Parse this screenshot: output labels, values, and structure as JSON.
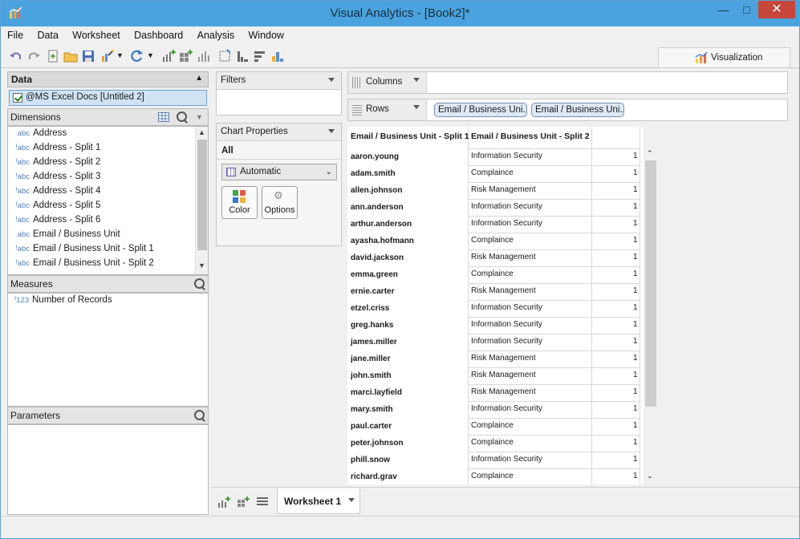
{
  "window": {
    "title": "Visual Analytics - [Book2]*",
    "controls": {
      "minimize": "—",
      "maximize": "□",
      "close": "✕"
    }
  },
  "menu": [
    "File",
    "Data",
    "Worksheet",
    "Dashboard",
    "Analysis",
    "Window"
  ],
  "tabs": {
    "visualization": "Visualization"
  },
  "data_panel": {
    "title": "Data",
    "datasource": "@MS Excel Docs [Untitled 2]"
  },
  "dimensions": {
    "title": "Dimensions",
    "items": [
      {
        "type": "abc",
        "label": "Address"
      },
      {
        "type": "fabc",
        "label": "Address - Split 1"
      },
      {
        "type": "fabc",
        "label": "Address - Split 2"
      },
      {
        "type": "fabc",
        "label": "Address - Split 3"
      },
      {
        "type": "fabc",
        "label": "Address - Split 4"
      },
      {
        "type": "fabc",
        "label": "Address - Split 5"
      },
      {
        "type": "fabc",
        "label": "Address - Split 6"
      },
      {
        "type": "abc",
        "label": "Email / Business Unit"
      },
      {
        "type": "fabc",
        "label": "Email / Business Unit - Split 1"
      },
      {
        "type": "fabc",
        "label": "Email / Business Unit - Split 2"
      }
    ]
  },
  "measures": {
    "title": "Measures",
    "items": [
      {
        "type": "f123",
        "label": "Number of Records"
      }
    ]
  },
  "parameters": {
    "title": "Parameters"
  },
  "filters": {
    "title": "Filters"
  },
  "chart_properties": {
    "title": "Chart Properties",
    "all_label": "All",
    "mark_type": "Automatic",
    "color_label": "Color",
    "options_label": "Options"
  },
  "shelves": {
    "columns_label": "Columns",
    "rows_label": "Rows",
    "row_pills": [
      "Email / Business Uni...",
      "Email / Business Uni..."
    ]
  },
  "table": {
    "headers": [
      "Email / Business Unit - Split 1",
      "Email / Business Unit - Split 2"
    ],
    "rows": [
      [
        "aaron.young",
        "Information Security",
        "1"
      ],
      [
        "adam.smith",
        "Complaince",
        "1"
      ],
      [
        "allen.johnson",
        "Risk Management",
        "1"
      ],
      [
        "ann.anderson",
        "Information Security",
        "1"
      ],
      [
        "arthur.anderson",
        "Information Security",
        "1"
      ],
      [
        "ayasha.hofmann",
        "Complaince",
        "1"
      ],
      [
        "david.jackson",
        "Risk Management",
        "1"
      ],
      [
        "emma.green",
        "Complaince",
        "1"
      ],
      [
        "ernie.carter",
        "Risk Management",
        "1"
      ],
      [
        "etzel.criss",
        "Information Security",
        "1"
      ],
      [
        "greg.hanks",
        "Information Security",
        "1"
      ],
      [
        "james.miller",
        "Information Security",
        "1"
      ],
      [
        "jane.miller",
        "Risk Management",
        "1"
      ],
      [
        "john.smith",
        "Risk Management",
        "1"
      ],
      [
        "marci.layfield",
        "Risk Management",
        "1"
      ],
      [
        "mary.smith",
        "Information Security",
        "1"
      ],
      [
        "paul.carter",
        "Complaince",
        "1"
      ],
      [
        "peter.johnson",
        "Complaince",
        "1"
      ],
      [
        "phill.snow",
        "Information Security",
        "1"
      ],
      [
        "richard.grav",
        "Complaince",
        "1"
      ]
    ]
  },
  "sheets": {
    "active": "Worksheet 1"
  },
  "icons": {
    "undo": "undo-icon",
    "redo": "redo-icon",
    "new": "new-icon",
    "open": "open-folder-icon",
    "save": "save-icon",
    "refresh": "refresh-icon",
    "search": "search-icon"
  },
  "colors": {
    "titlebar": "#4aa3df",
    "close": "#c7463a",
    "pill": "#dfe9f5",
    "selection": "#cfe3f5"
  }
}
